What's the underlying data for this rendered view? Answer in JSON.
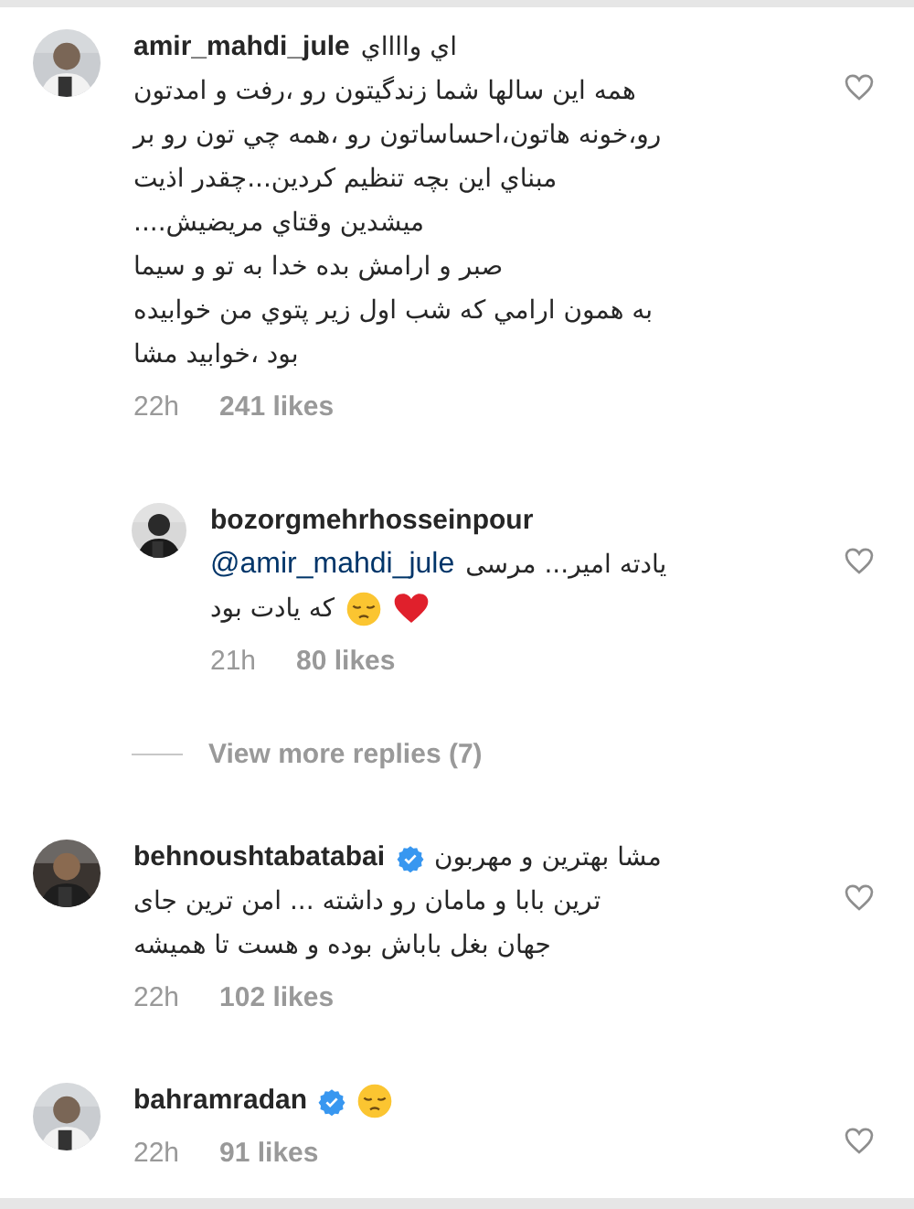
{
  "comments": [
    {
      "username": "amir_mahdi_jule",
      "verified": false,
      "reply": false,
      "first_line": "اي وااااي",
      "body": "همه این سالها شما زندگیتون رو ،رفت و امدتون\nرو،خونه هاتون،احساساتون رو ،همه چي تون رو بر\nمبناي این بچه تنظیم کردین...چقدر اذیت\nمیشدین وقتاي مریضیش....\nصبر و ارامش بده خدا به تو و سیما\nبه همون ارامي که شب اول زیر پتوي من خوابیده\nبود ،خوابید مشا",
      "time": "22h",
      "likes": "241 likes",
      "liked": false
    },
    {
      "username": "bozorgmehrhosseinpour",
      "verified": false,
      "reply": true,
      "mention": "@amir_mahdi_jule",
      "mention_text": "یادته امیر... مرسی",
      "body": "که یادت بود",
      "icons": [
        {
          "kind": "heart"
        },
        {
          "kind": "pensive"
        }
      ],
      "time": "21h",
      "likes": "80 likes",
      "liked": false
    },
    {
      "kind": "view_more",
      "label": "View more replies (7)"
    },
    {
      "username": "behnoushtabatabai",
      "verified": true,
      "reply": false,
      "first_line": "مشا بهترین و مهربون",
      "body": "ترین بابا و مامان رو داشته ... امن ترین جای\nجهان بغل باباش بوده و هست تا همیشه",
      "time": "22h",
      "likes": "102 likes",
      "liked": false
    },
    {
      "username": "bahramradan",
      "verified": true,
      "reply": false,
      "header_icons": [
        {
          "kind": "pensive"
        }
      ],
      "time": "22h",
      "likes": "91 likes",
      "liked": false
    }
  ]
}
